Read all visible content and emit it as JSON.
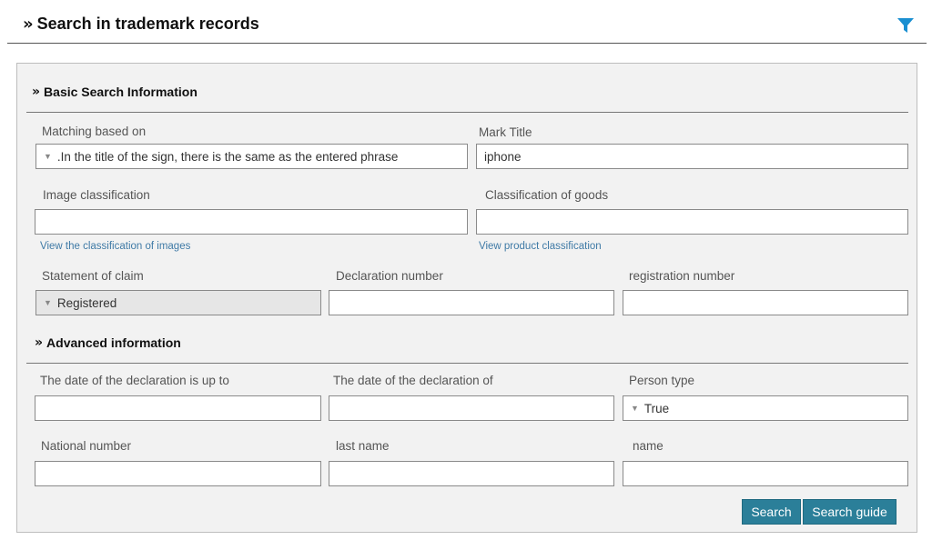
{
  "header": {
    "chevrons": "»",
    "title": "Search in trademark records",
    "filter_icon": "funnel-icon"
  },
  "colors": {
    "accent": "#2b7f99",
    "link": "#3f7aa6",
    "filter": "#1a8fd1"
  },
  "basic": {
    "chevrons": "»",
    "title": "Basic Search Information",
    "matching_label": "Matching based on",
    "matching_value": ".In the title of the sign, there is the same as the entered phrase",
    "mark_title_label": "Mark Title",
    "mark_title_value": "iphone",
    "image_class_label": "Image classification",
    "image_class_value": "",
    "image_class_link": "View the classification of images",
    "goods_class_label": "Classification of goods",
    "goods_class_value": "",
    "goods_class_link": "View product classification",
    "claim_label": "Statement of claim",
    "claim_value": "Registered",
    "declaration_number_label": "Declaration number",
    "declaration_number_value": "",
    "registration_number_label": "registration number",
    "registration_number_value": ""
  },
  "advanced": {
    "chevrons": "»",
    "title": "Advanced information",
    "date_to_label": "The date of the declaration is up to",
    "date_to_value": "",
    "date_from_label": "The date of the declaration of",
    "date_from_value": "",
    "person_type_label": "Person type",
    "person_type_value": "True",
    "national_number_label": "National number",
    "national_number_value": "",
    "last_name_label": "last name",
    "last_name_value": "",
    "name_label": "name",
    "name_value": ""
  },
  "actions": {
    "search": "Search",
    "search_guide": "Search guide"
  }
}
